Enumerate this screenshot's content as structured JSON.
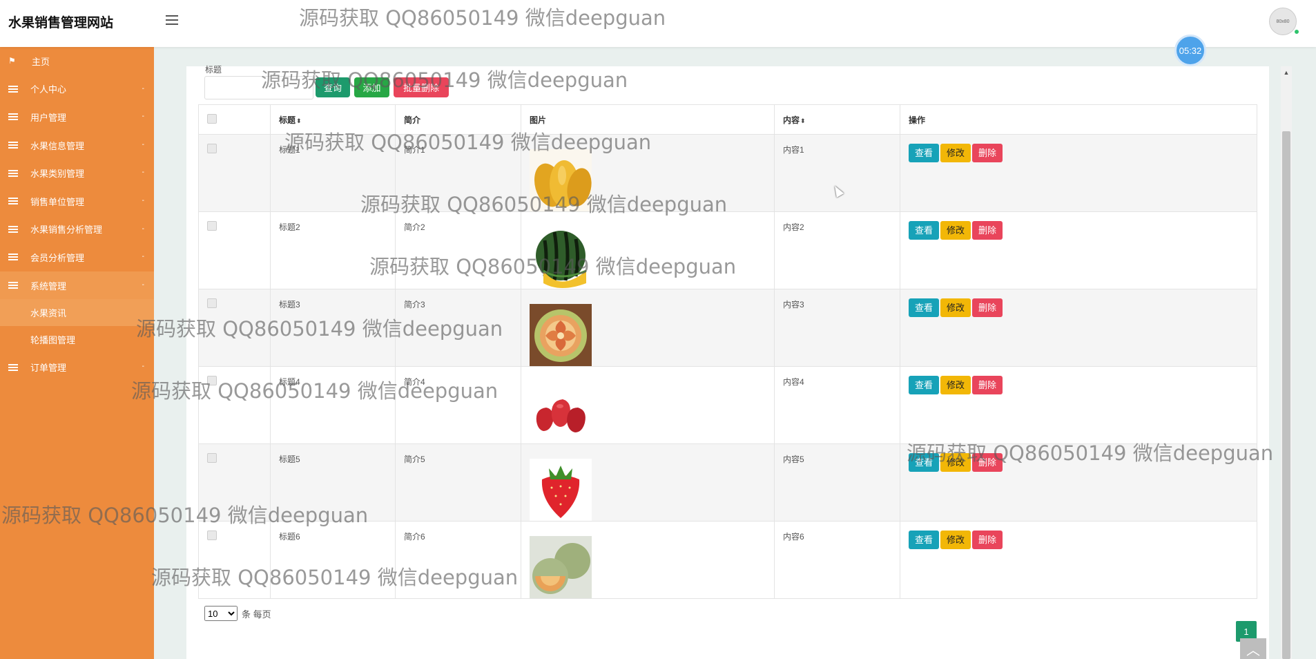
{
  "app": {
    "title": "水果销售管理网站",
    "avatar_text": "80x80",
    "clock": "05:32"
  },
  "sidebar": {
    "items": [
      {
        "label": "主页",
        "icon": "flag-icon"
      },
      {
        "label": "个人中心",
        "icon": "menu-icon"
      },
      {
        "label": "用户管理",
        "icon": "menu-icon"
      },
      {
        "label": "水果信息管理",
        "icon": "menu-icon"
      },
      {
        "label": "水果类别管理",
        "icon": "menu-icon"
      },
      {
        "label": "销售单位管理",
        "icon": "menu-icon"
      },
      {
        "label": "水果销售分析管理",
        "icon": "menu-icon"
      },
      {
        "label": "会员分析管理",
        "icon": "menu-icon"
      },
      {
        "label": "系统管理",
        "icon": "menu-icon"
      },
      {
        "label": "订单管理",
        "icon": "menu-icon"
      }
    ],
    "system_sub": [
      {
        "label": "水果资讯"
      },
      {
        "label": "轮播图管理"
      }
    ],
    "colors": {
      "background": "#ed8b3d"
    }
  },
  "search": {
    "label": "标题",
    "value": "",
    "query_label": "查询",
    "add_label": "添加",
    "batch_delete_label": "批量删除"
  },
  "table": {
    "headers": {
      "title": "标题",
      "intro": "简介",
      "image": "图片",
      "content": "内容",
      "actions": "操作"
    },
    "rows": [
      {
        "title": "标题1",
        "intro": "简介1",
        "image": "mango",
        "content": "内容1"
      },
      {
        "title": "标题2",
        "intro": "简介2",
        "image": "watermelon",
        "content": "内容2"
      },
      {
        "title": "标题3",
        "intro": "简介3",
        "image": "carved-melon",
        "content": "内容3"
      },
      {
        "title": "标题4",
        "intro": "简介4",
        "image": "wax-apple",
        "content": "内容4"
      },
      {
        "title": "标题5",
        "intro": "简介5",
        "image": "strawberry",
        "content": "内容5"
      },
      {
        "title": "标题6",
        "intro": "简介6",
        "image": "cantaloupe",
        "content": "内容6"
      }
    ],
    "action_labels": {
      "view": "查看",
      "edit": "修改",
      "delete": "删除"
    },
    "colors": {
      "view": "#17a2b8",
      "edit": "#f2b707",
      "delete": "#e9455b"
    }
  },
  "pagination": {
    "page_size": "10",
    "page_size_options": [
      "10"
    ],
    "page_size_suffix": "条 每页",
    "current_page": "1"
  },
  "watermark": "源码获取 QQ86050149 微信deepguan"
}
